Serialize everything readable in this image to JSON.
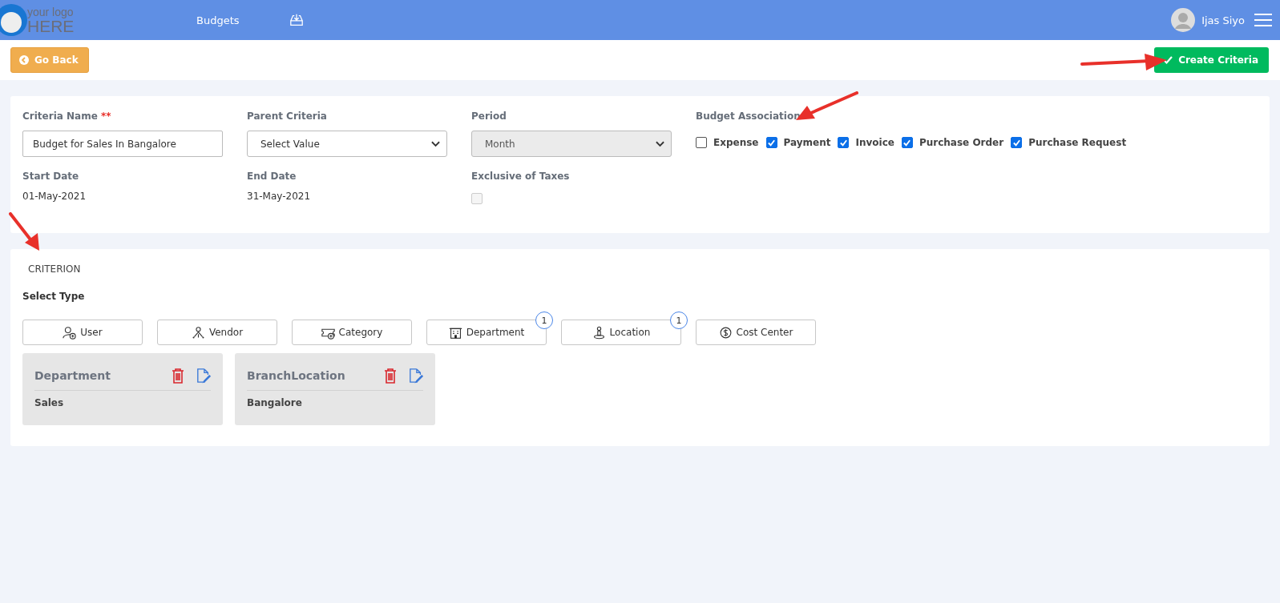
{
  "header": {
    "logo": {
      "line_1": "your logo",
      "line_2": "HERE"
    },
    "nav": [
      {
        "kind": "text",
        "label": "Budgets"
      },
      {
        "kind": "icon"
      }
    ],
    "user": {
      "name": "Ijas Siyo"
    }
  },
  "actions": {
    "back": {
      "label": "Go Back"
    },
    "create": {
      "label": "Create Criteria"
    }
  },
  "details": {
    "criteria_name": {
      "label": "Criteria Name",
      "required_mark": "**",
      "value": "Budget for Sales In Bangalore"
    },
    "parent_criteria": {
      "label": "Parent Criteria",
      "value": "Select Value",
      "disabled": false
    },
    "period": {
      "label": "Period",
      "value": "Month",
      "disabled": true
    },
    "budget_association": {
      "label": "Budget Association",
      "options": [
        {
          "label": "Expense",
          "checked": false
        },
        {
          "label": "Payment",
          "checked": true
        },
        {
          "label": "Invoice",
          "checked": true
        },
        {
          "label": "Purchase Order",
          "checked": true
        },
        {
          "label": "Purchase Request",
          "checked": true
        }
      ]
    },
    "start_date": {
      "label": "Start Date",
      "value": "01-May-2021"
    },
    "end_date": {
      "label": "End Date",
      "value": "31-May-2021"
    },
    "exclusive_of_taxes": {
      "label": "Exclusive of Taxes",
      "checked": false,
      "disabled": true
    }
  },
  "criterion": {
    "title": "CRITERION",
    "select_type_label": "Select Type",
    "types": [
      {
        "kind": "user",
        "label": "User"
      },
      {
        "kind": "vendor",
        "label": "Vendor"
      },
      {
        "kind": "category",
        "label": "Category"
      },
      {
        "kind": "department",
        "label": "Department",
        "count": "1"
      },
      {
        "kind": "location",
        "label": "Location",
        "count": "1"
      },
      {
        "kind": "cost_center",
        "label": "Cost Center"
      }
    ],
    "items": [
      {
        "title": "Department",
        "value": "Sales"
      },
      {
        "title": "BranchLocation",
        "value": "Bangalore"
      }
    ]
  }
}
